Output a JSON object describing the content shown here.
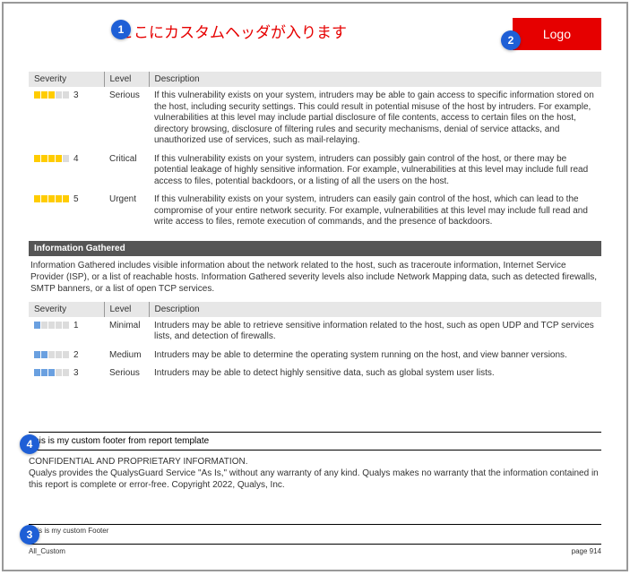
{
  "header": {
    "custom_header_text": "ここにカスタムヘッダが入ります",
    "logo_label": "Logo"
  },
  "callouts": {
    "c1": "1",
    "c2": "2",
    "c3": "3",
    "c4": "4"
  },
  "table1": {
    "head": {
      "severity": "Severity",
      "level": "Level",
      "description": "Description"
    },
    "rows": [
      {
        "num": "3",
        "fill": 3,
        "color": "y",
        "level": "Serious",
        "desc": "If this vulnerability exists on your system, intruders may be able to gain access to specific information stored on the host, including security settings. This could result in potential misuse of the host by intruders. For example, vulnerabilities at this level may include partial disclosure of file contents, access to certain files on the host, directory browsing, disclosure of filtering rules and security mechanisms, denial of service attacks, and unauthorized use of services, such as mail-relaying."
      },
      {
        "num": "4",
        "fill": 4,
        "color": "y",
        "level": "Critical",
        "desc": "If this vulnerability exists on your system, intruders can possibly gain control of the host, or there may be potential leakage of highly sensitive information. For example, vulnerabilities at this level may include full read access to files, potential backdoors, or a listing of all the users on the host."
      },
      {
        "num": "5",
        "fill": 5,
        "color": "y",
        "level": "Urgent",
        "desc": "If this vulnerability exists on your system, intruders can easily gain control of the host, which can lead to the compromise of your entire network security. For example, vulnerabilities at this level may include full read and write access to files, remote execution of commands, and the presence of backdoors."
      }
    ]
  },
  "info_section": {
    "title": "Information Gathered",
    "desc": "Information Gathered includes visible information about the network related to the host, such as traceroute information, Internet Service Provider (ISP), or a list of reachable hosts. Information Gathered severity levels also include Network Mapping data, such as detected firewalls, SMTP banners, or a list of open TCP services."
  },
  "table2": {
    "head": {
      "severity": "Severity",
      "level": "Level",
      "description": "Description"
    },
    "rows": [
      {
        "num": "1",
        "fill": 1,
        "color": "b",
        "level": "Minimal",
        "desc": "Intruders may be able to retrieve sensitive information related to the host, such as open UDP and TCP services lists, and detection of firewalls."
      },
      {
        "num": "2",
        "fill": 2,
        "color": "b",
        "level": "Medium",
        "desc": "Intruders may be able to determine the operating system running on the host, and view banner versions."
      },
      {
        "num": "3",
        "fill": 3,
        "color": "b",
        "level": "Serious",
        "desc": "Intruders may be able to detect highly sensitive data, such as global system user lists."
      }
    ]
  },
  "footer": {
    "custom_footer_template": "This is my custom footer from report template",
    "confidential_title": "CONFIDENTIAL AND PROPRIETARY INFORMATION.",
    "confidential_body": "Qualys provides the QualysGuard Service \"As Is,\" without any warranty of any kind. Qualys makes no warranty that the information contained in this report is complete or error-free. Copyright 2022, Qualys, Inc.",
    "custom_footer_small": "This is my custom Footer",
    "left": "All_Custom",
    "right": "page 914"
  }
}
